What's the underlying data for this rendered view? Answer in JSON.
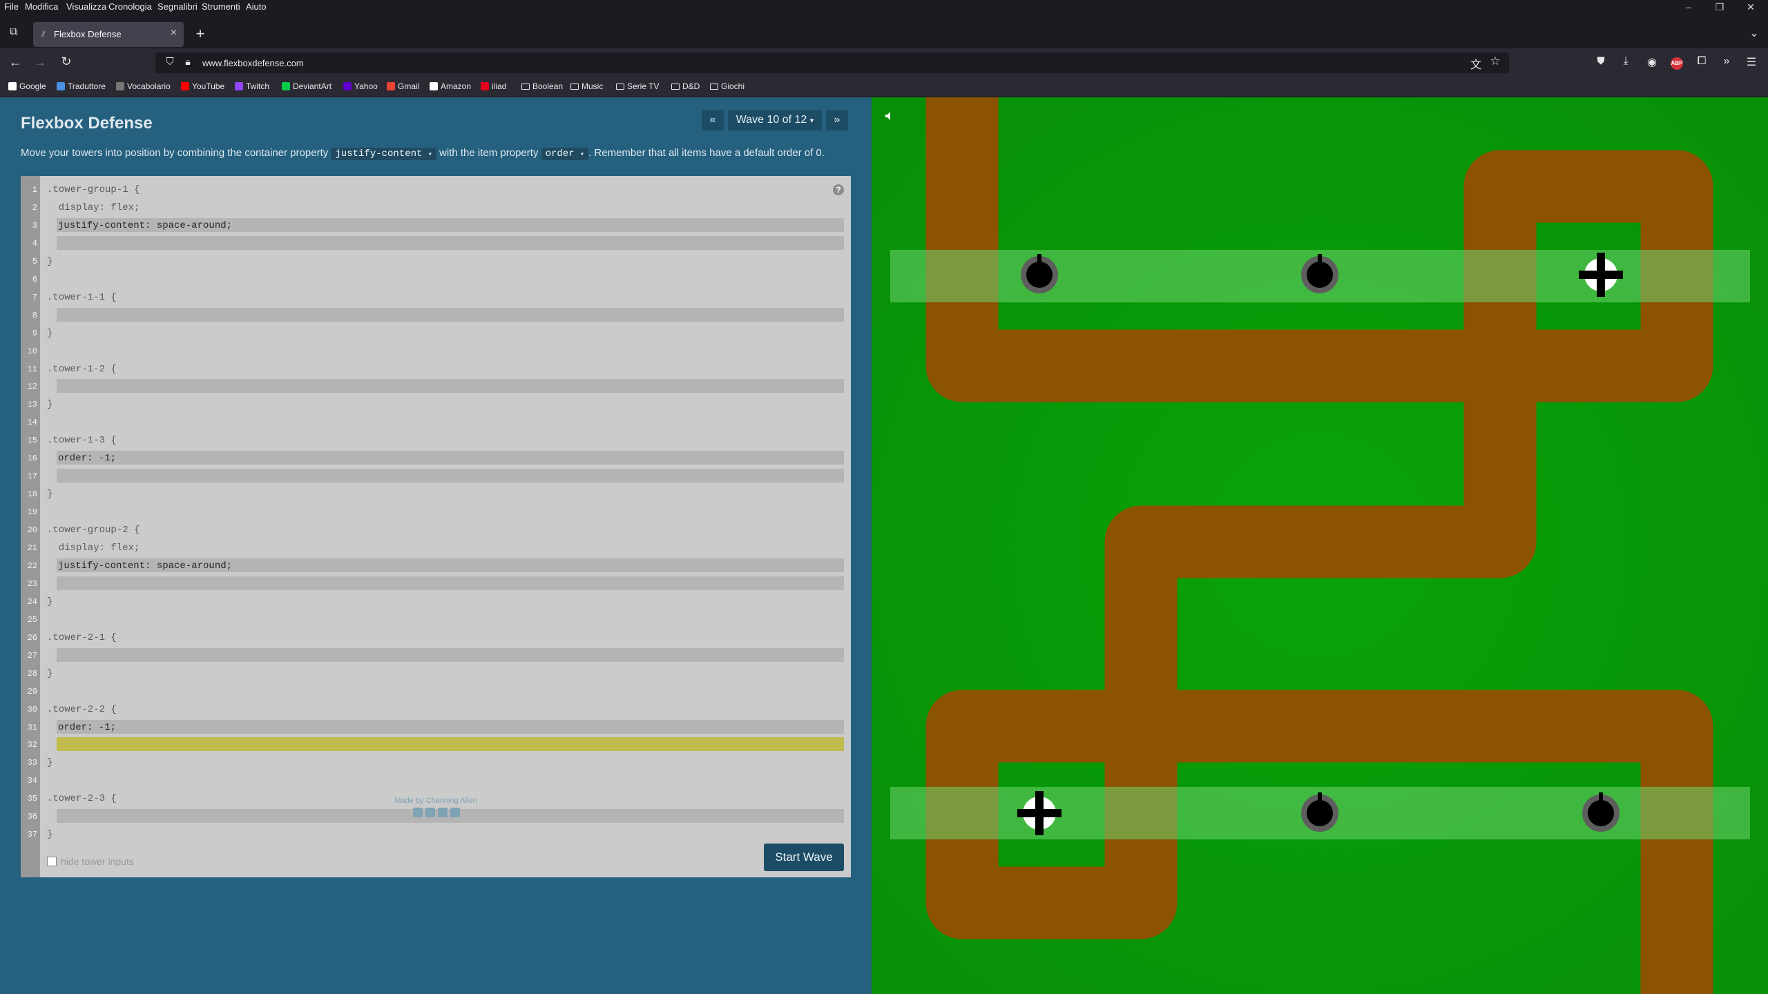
{
  "browser": {
    "menu": [
      "File",
      "Modifica",
      "Visualizza",
      "Cronologia",
      "Segnalibri",
      "Strumenti",
      "Aiuto"
    ],
    "tab_title": "Flexbox Defense",
    "url": "www.flexboxdefense.com",
    "bookmarks": [
      {
        "label": "Google",
        "icon": "google-icon",
        "color": "#ffffff"
      },
      {
        "label": "Traduttore",
        "icon": "translate-icon",
        "color": "#4a90e2"
      },
      {
        "label": "Vocabolario",
        "icon": "treccani-icon",
        "color": "#777777"
      },
      {
        "label": "YouTube",
        "icon": "youtube-icon",
        "color": "#ff0000"
      },
      {
        "label": "Twitch",
        "icon": "twitch-icon",
        "color": "#9146ff"
      },
      {
        "label": "DeviantArt",
        "icon": "deviantart-icon",
        "color": "#05cc47"
      },
      {
        "label": "Yahoo",
        "icon": "yahoo-icon",
        "color": "#6001d2"
      },
      {
        "label": "Gmail",
        "icon": "gmail-icon",
        "color": "#ea4335"
      },
      {
        "label": "Amazon",
        "icon": "amazon-icon",
        "color": "#ffffff"
      },
      {
        "label": "iliad",
        "icon": "iliad-icon",
        "color": "#e3001b"
      },
      {
        "label": "Boolean",
        "icon": "folder-icon"
      },
      {
        "label": "Music",
        "icon": "folder-icon"
      },
      {
        "label": "Serie TV",
        "icon": "folder-icon"
      },
      {
        "label": "D&D",
        "icon": "folder-icon"
      },
      {
        "label": "Giochi",
        "icon": "folder-icon"
      }
    ]
  },
  "game": {
    "title": "Flexbox Defense",
    "wave_label": "Wave 10 of 12",
    "prev_label": "«",
    "next_label": "»",
    "instructions": {
      "prefix": "Move your towers into position by combining the container property",
      "prop1": "justify-content",
      "middle": "with the item property",
      "prop2": "order",
      "suffix": ". Remember that all items have a default order of 0."
    },
    "code_lines": [
      {
        "n": "1",
        "text": ".tower-group-1 {"
      },
      {
        "n": "2",
        "text": "  display: flex;"
      },
      {
        "n": "3",
        "input": "justify-content: space-around;"
      },
      {
        "n": "4",
        "input": ""
      },
      {
        "n": "5",
        "text": "}"
      },
      {
        "n": "6",
        "text": ""
      },
      {
        "n": "7",
        "text": ".tower-1-1 {"
      },
      {
        "n": "8",
        "input": ""
      },
      {
        "n": "9",
        "text": "}"
      },
      {
        "n": "10",
        "text": ""
      },
      {
        "n": "11",
        "text": ".tower-1-2 {"
      },
      {
        "n": "12",
        "input": ""
      },
      {
        "n": "13",
        "text": "}"
      },
      {
        "n": "14",
        "text": ""
      },
      {
        "n": "15",
        "text": ".tower-1-3 {"
      },
      {
        "n": "16",
        "input": "order: -1;"
      },
      {
        "n": "17",
        "input": ""
      },
      {
        "n": "18",
        "text": "}"
      },
      {
        "n": "19",
        "text": ""
      },
      {
        "n": "20",
        "text": ".tower-group-2 {"
      },
      {
        "n": "21",
        "text": "  display: flex;"
      },
      {
        "n": "22",
        "input": "justify-content: space-around;"
      },
      {
        "n": "23",
        "input": ""
      },
      {
        "n": "24",
        "text": "}"
      },
      {
        "n": "25",
        "text": ""
      },
      {
        "n": "26",
        "text": ".tower-2-1 {"
      },
      {
        "n": "27",
        "input": ""
      },
      {
        "n": "28",
        "text": "}"
      },
      {
        "n": "29",
        "text": ""
      },
      {
        "n": "30",
        "text": ".tower-2-2 {"
      },
      {
        "n": "31",
        "input": "order: -1;"
      },
      {
        "n": "32",
        "input": "",
        "active": true
      },
      {
        "n": "33",
        "text": "}"
      },
      {
        "n": "34",
        "text": ""
      },
      {
        "n": "35",
        "text": ".tower-2-3 {"
      },
      {
        "n": "36",
        "input": ""
      },
      {
        "n": "37",
        "text": "}"
      }
    ],
    "help_label": "?",
    "hide_inputs_label": "hide tower inputs",
    "start_wave_label": "Start Wave",
    "credits": "Made by Channing Allen",
    "social_icons": [
      "facebook-icon",
      "twitter-icon",
      "linkedin-icon",
      "github-icon"
    ]
  },
  "colors": {
    "panel": "#25607f",
    "grass": "#0a9c0a",
    "path": "#8b5302",
    "tower_row": "#6fd46f",
    "active_input": "#c1bc4d"
  }
}
